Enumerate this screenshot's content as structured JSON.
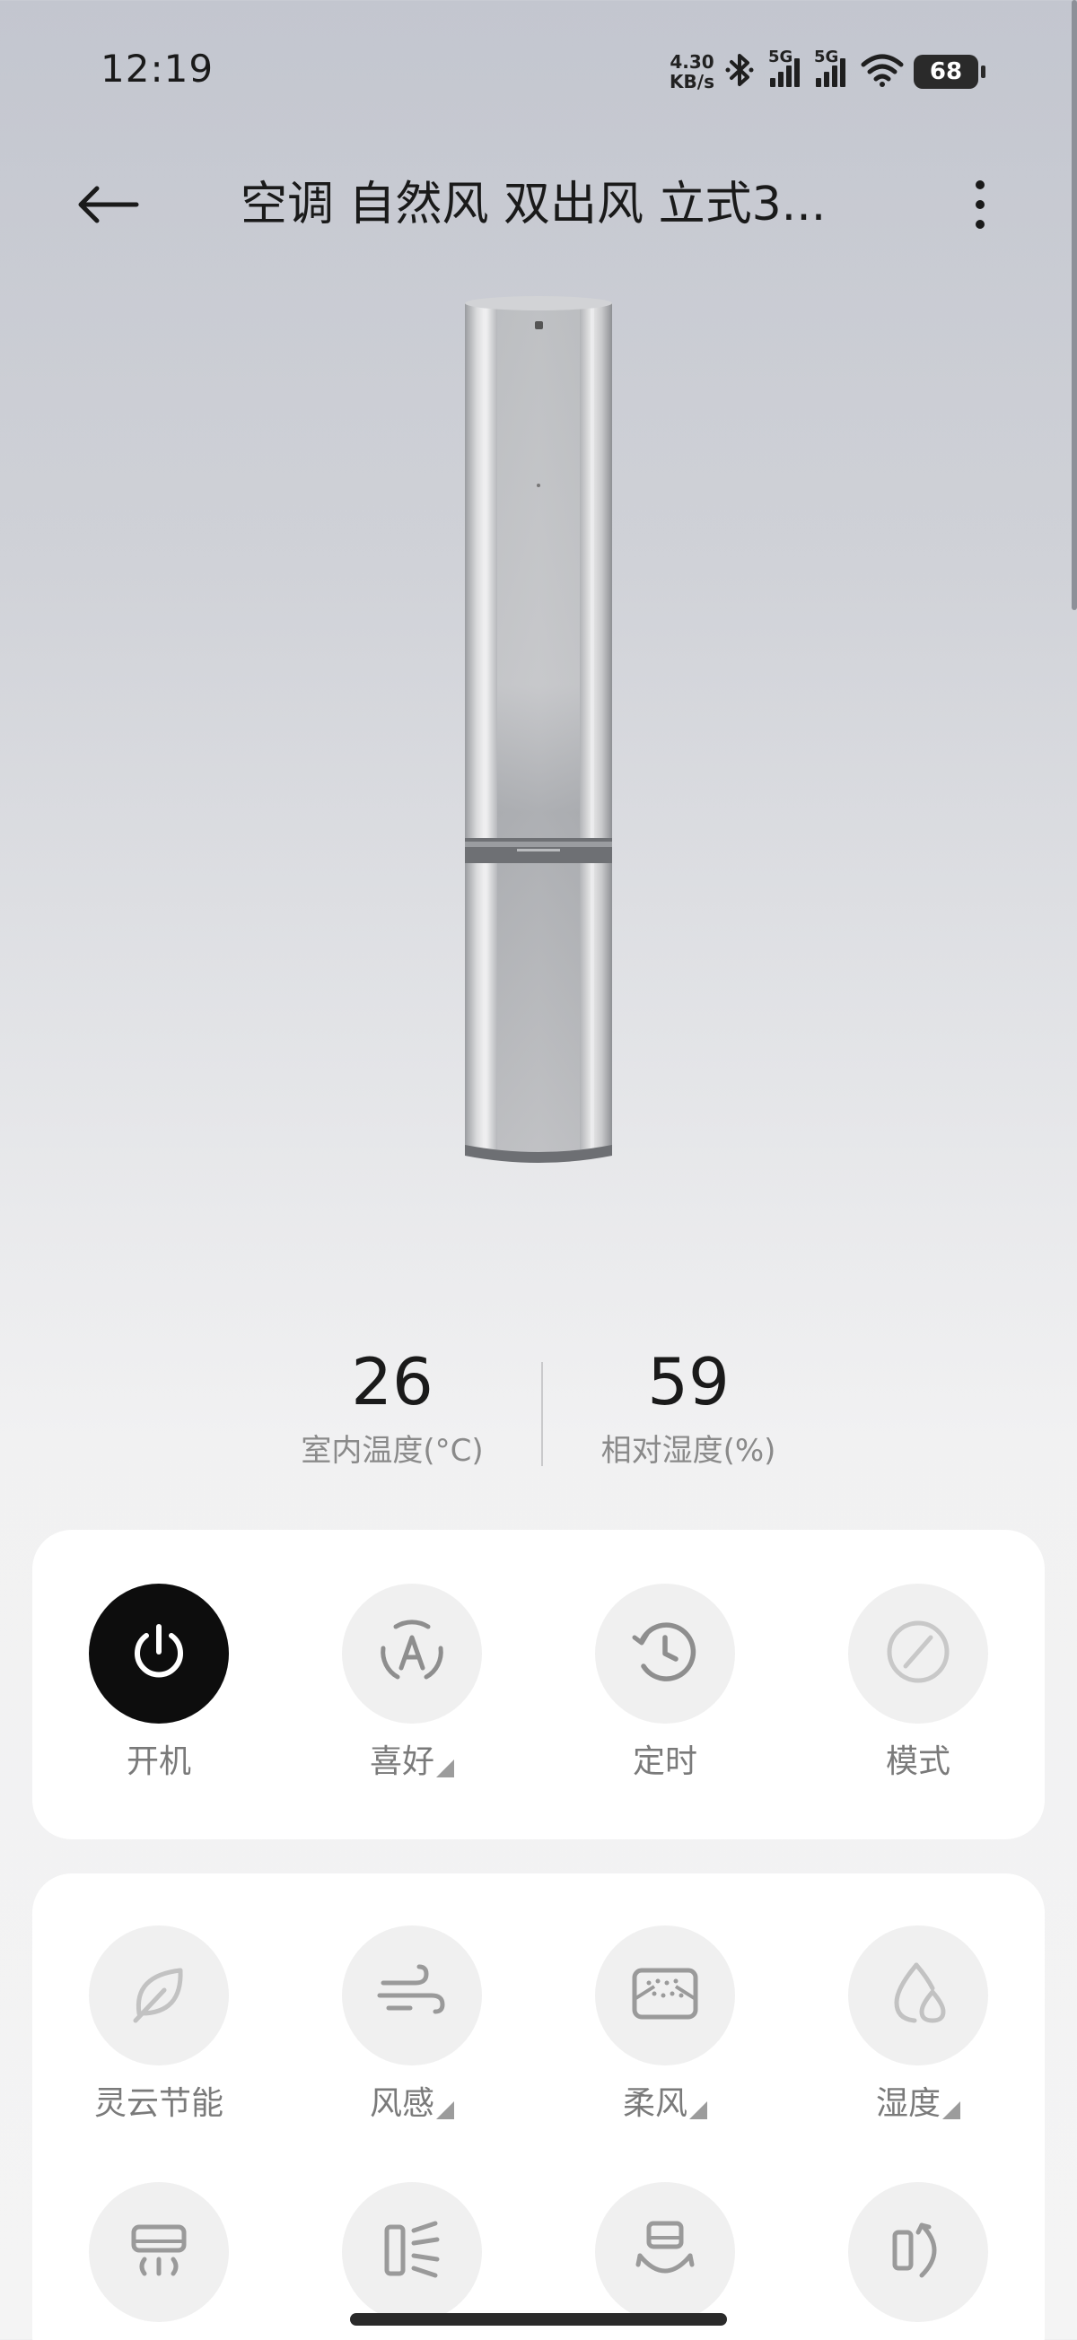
{
  "status_bar": {
    "time": "12:19",
    "net_speed_value": "4.30",
    "net_speed_unit": "KB/s",
    "sim1_label": "5G",
    "sim2_label": "5G",
    "battery": "68",
    "icons": [
      "bluetooth-icon",
      "signal-icon",
      "signal-icon",
      "wifi-icon",
      "battery-icon"
    ]
  },
  "header": {
    "back_icon": "back-arrow-icon",
    "title": "空调 自然风 双出风 立式3...",
    "more_icon": "more-vertical-icon"
  },
  "readings": {
    "temperature": {
      "value": "26",
      "label": "室内温度(°C)"
    },
    "humidity": {
      "value": "59",
      "label": "相对湿度(%)"
    }
  },
  "primary_controls": [
    {
      "label": "开机",
      "icon": "power-icon",
      "active": true,
      "has_dropdown": false
    },
    {
      "label": "喜好",
      "icon": "auto-a-icon",
      "active": false,
      "has_dropdown": true
    },
    {
      "label": "定时",
      "icon": "timer-clock-icon",
      "active": false,
      "has_dropdown": false
    },
    {
      "label": "模式",
      "icon": "mode-slash-icon",
      "active": false,
      "has_dropdown": false
    }
  ],
  "secondary_controls": [
    {
      "label": "灵云节能",
      "icon": "leaf-icon",
      "has_dropdown": false
    },
    {
      "label": "风感",
      "icon": "wind-icon",
      "has_dropdown": true
    },
    {
      "label": "柔风",
      "icon": "soft-wind-icon",
      "has_dropdown": true
    },
    {
      "label": "湿度",
      "icon": "humidity-drop-icon",
      "has_dropdown": true
    }
  ],
  "tertiary_controls": [
    {
      "icon": "ac-vent-icon"
    },
    {
      "icon": "horizontal-swing-icon"
    },
    {
      "icon": "vertical-swing-icon"
    },
    {
      "icon": "door-rotate-icon"
    }
  ],
  "colors": {
    "active_button": "#0d0d0d",
    "inactive_button": "#f0f0f0",
    "icon_gray": "#8e8e8e",
    "label_gray": "#7a7a7a"
  }
}
